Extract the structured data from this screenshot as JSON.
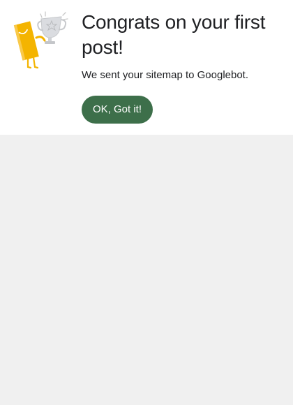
{
  "dialog": {
    "title": "Congrats on your first post!",
    "message": "We sent your sitemap to Googlebot.",
    "ok_button_label": "OK, Got it!",
    "illustration_icon": "character-holding-trophy-icon"
  },
  "colors": {
    "button_background": "#3d6f4a",
    "button_text": "#ffffff",
    "card_background": "#ffffff",
    "page_background": "#f0f0f0",
    "text_primary": "#202124",
    "character_yellow": "#f4b400",
    "trophy_gray": "#dadce0"
  }
}
